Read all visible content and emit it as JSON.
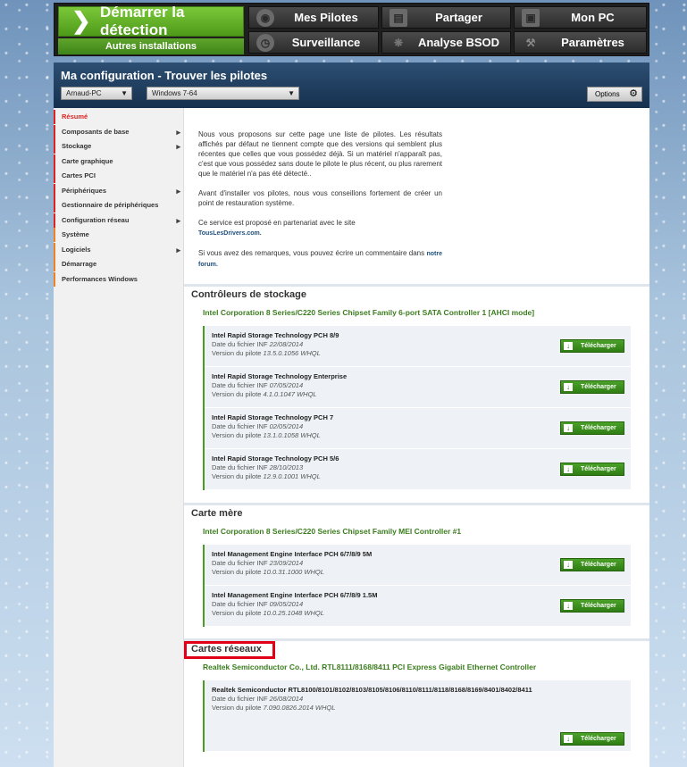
{
  "nav": {
    "start_label": "Démarrer la détection",
    "other_label": "Autres installations",
    "buttons": [
      {
        "label": "Mes Pilotes",
        "icon": "steering-wheel-icon"
      },
      {
        "label": "Partager",
        "icon": "share-box-icon"
      },
      {
        "label": "Mon PC",
        "icon": "monitor-icon"
      },
      {
        "label": "Surveillance",
        "icon": "clock-icon"
      },
      {
        "label": "Analyse BSOD",
        "icon": "bug-icon"
      },
      {
        "label": "Paramètres",
        "icon": "wrench-icon"
      }
    ]
  },
  "header": {
    "title": "Ma configuration - Trouver les pilotes",
    "pc_select": "Arnaud-PC",
    "os_select": "Windows 7-64",
    "options_label": "Options"
  },
  "sidebar": {
    "items": [
      {
        "label": "Résumé",
        "active": true,
        "arrow": false,
        "color": "#d22"
      },
      {
        "label": "Composants de base",
        "arrow": true,
        "color": "#d22"
      },
      {
        "label": "Stockage",
        "arrow": true,
        "color": "#d22"
      },
      {
        "label": "Carte graphique",
        "arrow": false,
        "color": "#d22"
      },
      {
        "label": "Cartes PCI",
        "arrow": false,
        "color": "#d22"
      },
      {
        "label": "Périphériques",
        "arrow": true,
        "color": "#d22"
      },
      {
        "label": "Gestionnaire de périphériques",
        "arrow": false,
        "color": "#d22"
      },
      {
        "label": "Configuration réseau",
        "arrow": true,
        "color": "#d22"
      },
      {
        "label": "Système",
        "arrow": false,
        "color": "#f08020"
      },
      {
        "label": "Logiciels",
        "arrow": true,
        "color": "#f08020"
      },
      {
        "label": "Démarrage",
        "arrow": false,
        "color": "#f08020"
      },
      {
        "label": "Performances Windows",
        "arrow": false,
        "color": "#f08020"
      }
    ]
  },
  "intro": {
    "p1": "Nous vous proposons sur cette page une liste de pilotes. Les résultats affichés par défaut ne tiennent compte que des versions qui semblent plus récentes que celles que vous possédez déjà. Si un matériel n'apparaît pas, c'est que vous possédez sans doute le pilote le plus récent, ou plus rarement que le matériel n'a pas été détecté..",
    "p2": "Avant d'installer vos pilotes, nous vous conseillons fortement de créer un point de restauration système.",
    "p3_text": "Ce service est proposé en partenariat avec le site",
    "p3_link": "TousLesDrivers.com.",
    "p4_text": "Si vous avez des remarques, vous pouvez écrire un commentaire dans",
    "p4_link": "notre forum."
  },
  "download_label": "Télécharger",
  "date_prefix": "Date du fichier INF",
  "version_prefix": "Version du pilote",
  "sections": [
    {
      "title": "Contrôleurs de stockage",
      "device": "Intel Corporation 8 Series/C220 Series Chipset Family 6-port SATA Controller 1 [AHCI mode]",
      "drivers": [
        {
          "name": "Intel Rapid Storage Technology PCH 8/9",
          "date": "22/08/2014",
          "version": "13.5.0.1056 WHQL"
        },
        {
          "name": "Intel Rapid Storage Technology Enterprise",
          "date": "07/05/2014",
          "version": "4.1.0.1047 WHQL"
        },
        {
          "name": "Intel Rapid Storage Technology PCH 7",
          "date": "02/05/2014",
          "version": "13.1.0.1058 WHQL"
        },
        {
          "name": "Intel Rapid Storage Technology PCH 5/6",
          "date": "28/10/2013",
          "version": "12.9.0.1001 WHQL"
        }
      ]
    },
    {
      "title": "Carte mère",
      "device": "Intel Corporation 8 Series/C220 Series Chipset Family MEI Controller #1",
      "drivers": [
        {
          "name": "Intel Management Engine Interface PCH 6/7/8/9 5M",
          "date": "23/09/2014",
          "version": "10.0.31.1000 WHQL"
        },
        {
          "name": "Intel Management Engine Interface PCH 6/7/8/9 1.5M",
          "date": "09/05/2014",
          "version": "10.0.25.1048 WHQL"
        }
      ]
    },
    {
      "title": "Cartes réseaux",
      "device": "Realtek Semiconductor Co., Ltd. RTL8111/8168/8411 PCI Express Gigabit Ethernet Controller",
      "drivers": [
        {
          "name": "Realtek Semiconductor RTL8100/8101/8102/8103/8105/8106/8110/8111/8118/8168/8169/8401/8402/8411",
          "date": "26/08/2014",
          "version": "7.090.0826.2014 WHQL"
        }
      ]
    }
  ]
}
